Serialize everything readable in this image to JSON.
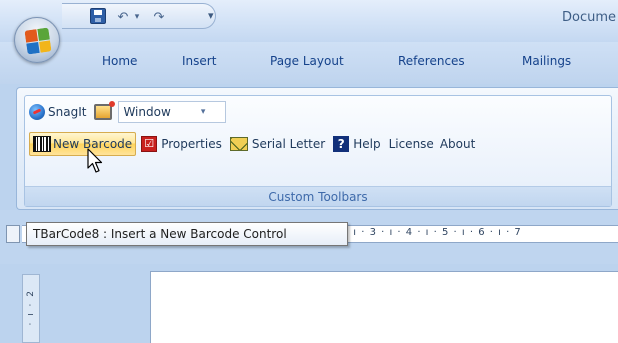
{
  "title_bar": {
    "document_title": "Docume"
  },
  "quick_access": {
    "icons": [
      "save-icon",
      "undo-icon",
      "redo-icon",
      "customize-icon"
    ],
    "undo_glyph": "↶",
    "undo_dd_glyph": "▾",
    "redo_glyph": "↷",
    "customize_glyph": "▾"
  },
  "tabs": [
    "Home",
    "Insert",
    "Page Layout",
    "References",
    "Mailings"
  ],
  "ribbon": {
    "group_label": "Custom Toolbars",
    "snagit_label": "SnagIt",
    "window_select_value": "Window",
    "window_select_arrow": "▾",
    "tools": {
      "new_barcode": "New Barcode",
      "properties": "Properties",
      "properties_glyph": "☑",
      "serial_letter": "Serial Letter",
      "help": "Help",
      "help_glyph": "?",
      "license": "License",
      "about": "About"
    }
  },
  "tooltip": {
    "text": "TBarCode8 : Insert a New Barcode Control"
  },
  "ruler": {
    "ticks": "· 2 · ı · 3 · ı · 4 · ı · 5 · ı · 6 · ı · 7",
    "vertical_ticks": "· ı · 2"
  },
  "colors": {
    "accent": "#15428b",
    "hover_highlight": "#ffd45b",
    "ribbon_background": "#dfeaf7"
  }
}
